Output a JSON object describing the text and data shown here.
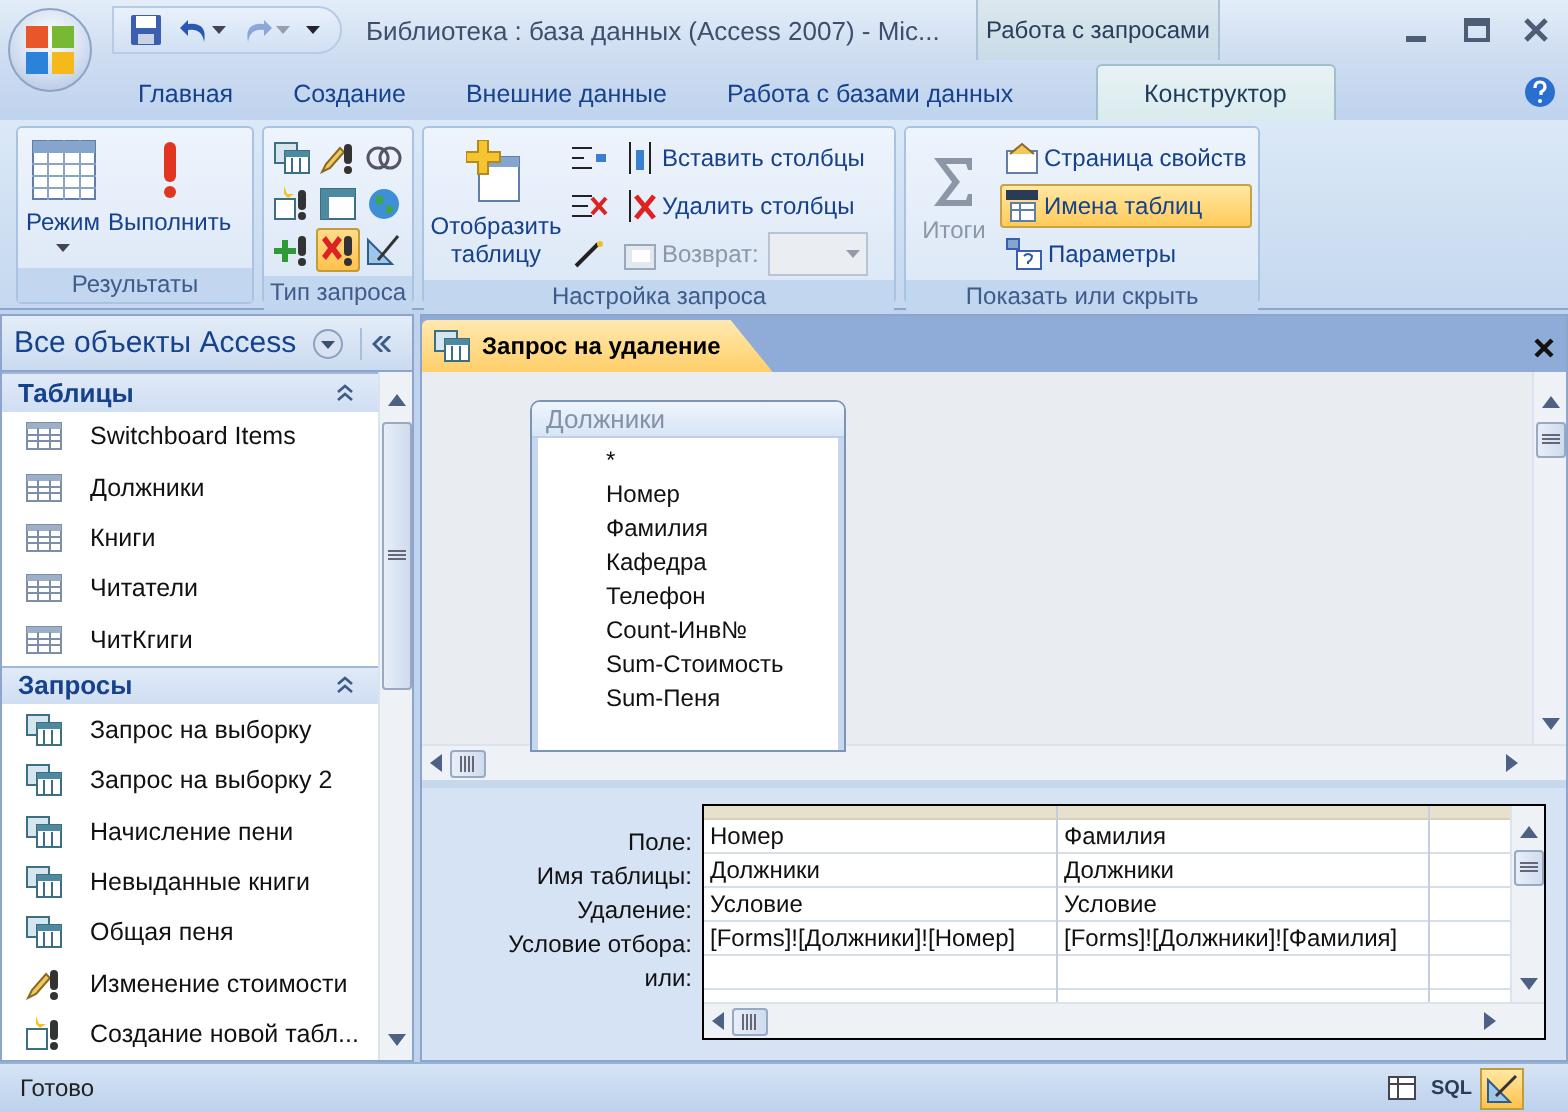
{
  "window": {
    "title": "Библиотека : база данных (Access 2007)  -  Mic...",
    "context_tab": "Работа с запросами"
  },
  "quick_access": [
    {
      "kind": "save",
      "disabled": false
    },
    {
      "kind": "undo",
      "disabled": false
    },
    {
      "kind": "redo",
      "disabled": true
    }
  ],
  "ribbon_tabs": [
    {
      "label": "Главная",
      "selected": false
    },
    {
      "label": "Создание",
      "selected": false
    },
    {
      "label": "Внешние данные",
      "selected": false
    },
    {
      "label": "Работа с базами данных",
      "selected": false
    },
    {
      "label": "Конструктор",
      "selected": true
    }
  ],
  "ribbon_groups": [
    {
      "kind": "results",
      "label": "Результаты",
      "buttons": [
        {
          "kind": "view",
          "label": "Режим"
        },
        {
          "kind": "run",
          "label": "Выполнить"
        }
      ]
    },
    {
      "kind": "query_type",
      "label": "Тип запроса",
      "buttons": [
        {
          "kind": "select",
          "selected": false
        },
        {
          "kind": "update",
          "selected": false
        },
        {
          "kind": "union",
          "selected": false
        },
        {
          "kind": "make_table",
          "selected": false
        },
        {
          "kind": "crosstab",
          "selected": false
        },
        {
          "kind": "pass_through",
          "selected": false
        },
        {
          "kind": "append",
          "selected": false
        },
        {
          "kind": "delete",
          "selected": true
        },
        {
          "kind": "data_definition",
          "selected": false
        }
      ]
    },
    {
      "kind": "setup",
      "label": "Настройка запроса",
      "show_table": "Отобразить таблицу",
      "column_actions": [
        {
          "kind": "insert",
          "label": "Вставить столбцы"
        },
        {
          "kind": "delete",
          "label": "Удалить столбцы"
        }
      ],
      "return": {
        "label": "Возврат:",
        "disabled": true
      }
    },
    {
      "kind": "show",
      "label": "Показать или скрыть",
      "totals": {
        "label": "Итоги",
        "disabled": true
      },
      "items": [
        {
          "kind": "property_sheet",
          "label": "Страница свойств",
          "selected": false
        },
        {
          "kind": "table_names",
          "label": "Имена таблиц",
          "selected": true
        },
        {
          "kind": "parameters",
          "label": "Параметры",
          "selected": false
        }
      ]
    }
  ],
  "nav_pane": {
    "title": "Все объекты Access",
    "groups": [
      {
        "label": "Таблицы",
        "items": [
          {
            "kind": "table",
            "label": "Switchboard Items"
          },
          {
            "kind": "table",
            "label": "Должники"
          },
          {
            "kind": "table",
            "label": "Книги"
          },
          {
            "kind": "table",
            "label": "Читатели"
          },
          {
            "kind": "table",
            "label": "ЧитКгиги"
          }
        ]
      },
      {
        "label": "Запросы",
        "items": [
          {
            "kind": "select",
            "label": "Запрос на выборку"
          },
          {
            "kind": "select",
            "label": "Запрос на выборку 2"
          },
          {
            "kind": "select",
            "label": "Начисление пени"
          },
          {
            "kind": "select",
            "label": "Невыданные книги"
          },
          {
            "kind": "select",
            "label": "Общая пеня"
          },
          {
            "kind": "update",
            "label": "Изменение стоимости"
          },
          {
            "kind": "make_table",
            "label": "Создание новой табл..."
          }
        ]
      }
    ]
  },
  "document": {
    "tab": "Запрос на удаление",
    "field_list": {
      "title": "Должники",
      "fields": [
        "*",
        "Номер",
        "Фамилия",
        "Кафедра",
        "Телефон",
        "Count-Инв№",
        "Sum-Стоимость",
        "Sum-Пеня"
      ]
    },
    "grid": {
      "row_labels": [
        "Поле:",
        "Имя таблицы:",
        "Удаление:",
        "Условие отбора:",
        "или:"
      ],
      "columns": [
        {
          "cells": [
            "Номер",
            "Должники",
            "Условие",
            "[Forms]![Должники]![Номер]"
          ]
        },
        {
          "cells": [
            "Фамилия",
            "Должники",
            "Условие",
            "[Forms]![Должники]![Фамилия]"
          ]
        }
      ]
    }
  },
  "status_bar": {
    "text": "Готово",
    "views": [
      {
        "kind": "datasheet",
        "selected": false
      },
      {
        "kind": "sql",
        "label": "SQL",
        "selected": false
      },
      {
        "kind": "design",
        "selected": true
      }
    ]
  }
}
